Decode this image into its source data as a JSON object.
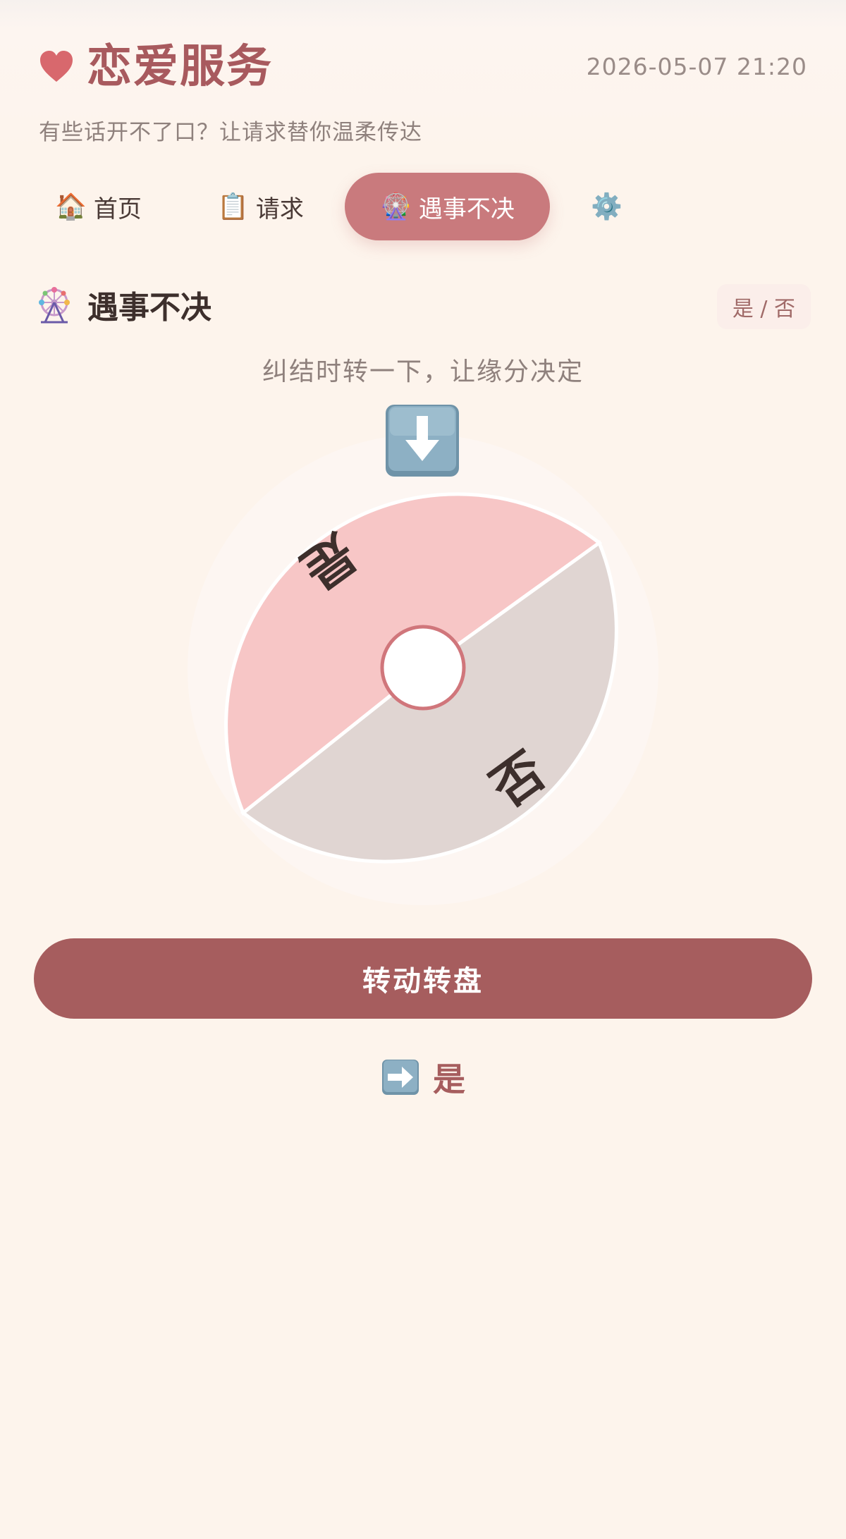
{
  "header": {
    "title": "恋爱服务",
    "datetime": "2026-05-07 21:20",
    "subtitle": "有些话开不了口？让请求替你温柔传达"
  },
  "nav": {
    "tabs": [
      {
        "icon": "🏠",
        "icon_name": "house-icon",
        "label": "首页",
        "active": false
      },
      {
        "icon": "📋",
        "icon_name": "clipboard-icon",
        "label": "请求",
        "active": false
      },
      {
        "icon": "🎡",
        "icon_name": "ferris-wheel-icon",
        "label": "遇事不决",
        "active": true
      },
      {
        "icon": "⚙️",
        "icon_name": "gear-icon",
        "label": "",
        "active": false
      }
    ]
  },
  "section": {
    "title": "遇事不决",
    "badge": "是 / 否",
    "hint": "纠结时转一下，让缘分决定"
  },
  "wheel": {
    "segments": [
      {
        "label": "是",
        "color": "#f7c6c6"
      },
      {
        "label": "否",
        "color": "#e0d5d2"
      }
    ],
    "center_color": "#ffffff",
    "center_ring_color": "#d0767b"
  },
  "actions": {
    "spin_label": "转动转盘"
  },
  "result": {
    "value": "是"
  },
  "colors": {
    "accent": "#a65d5e",
    "active_tab": "#c97a7d",
    "background": "#fdf4ec"
  }
}
